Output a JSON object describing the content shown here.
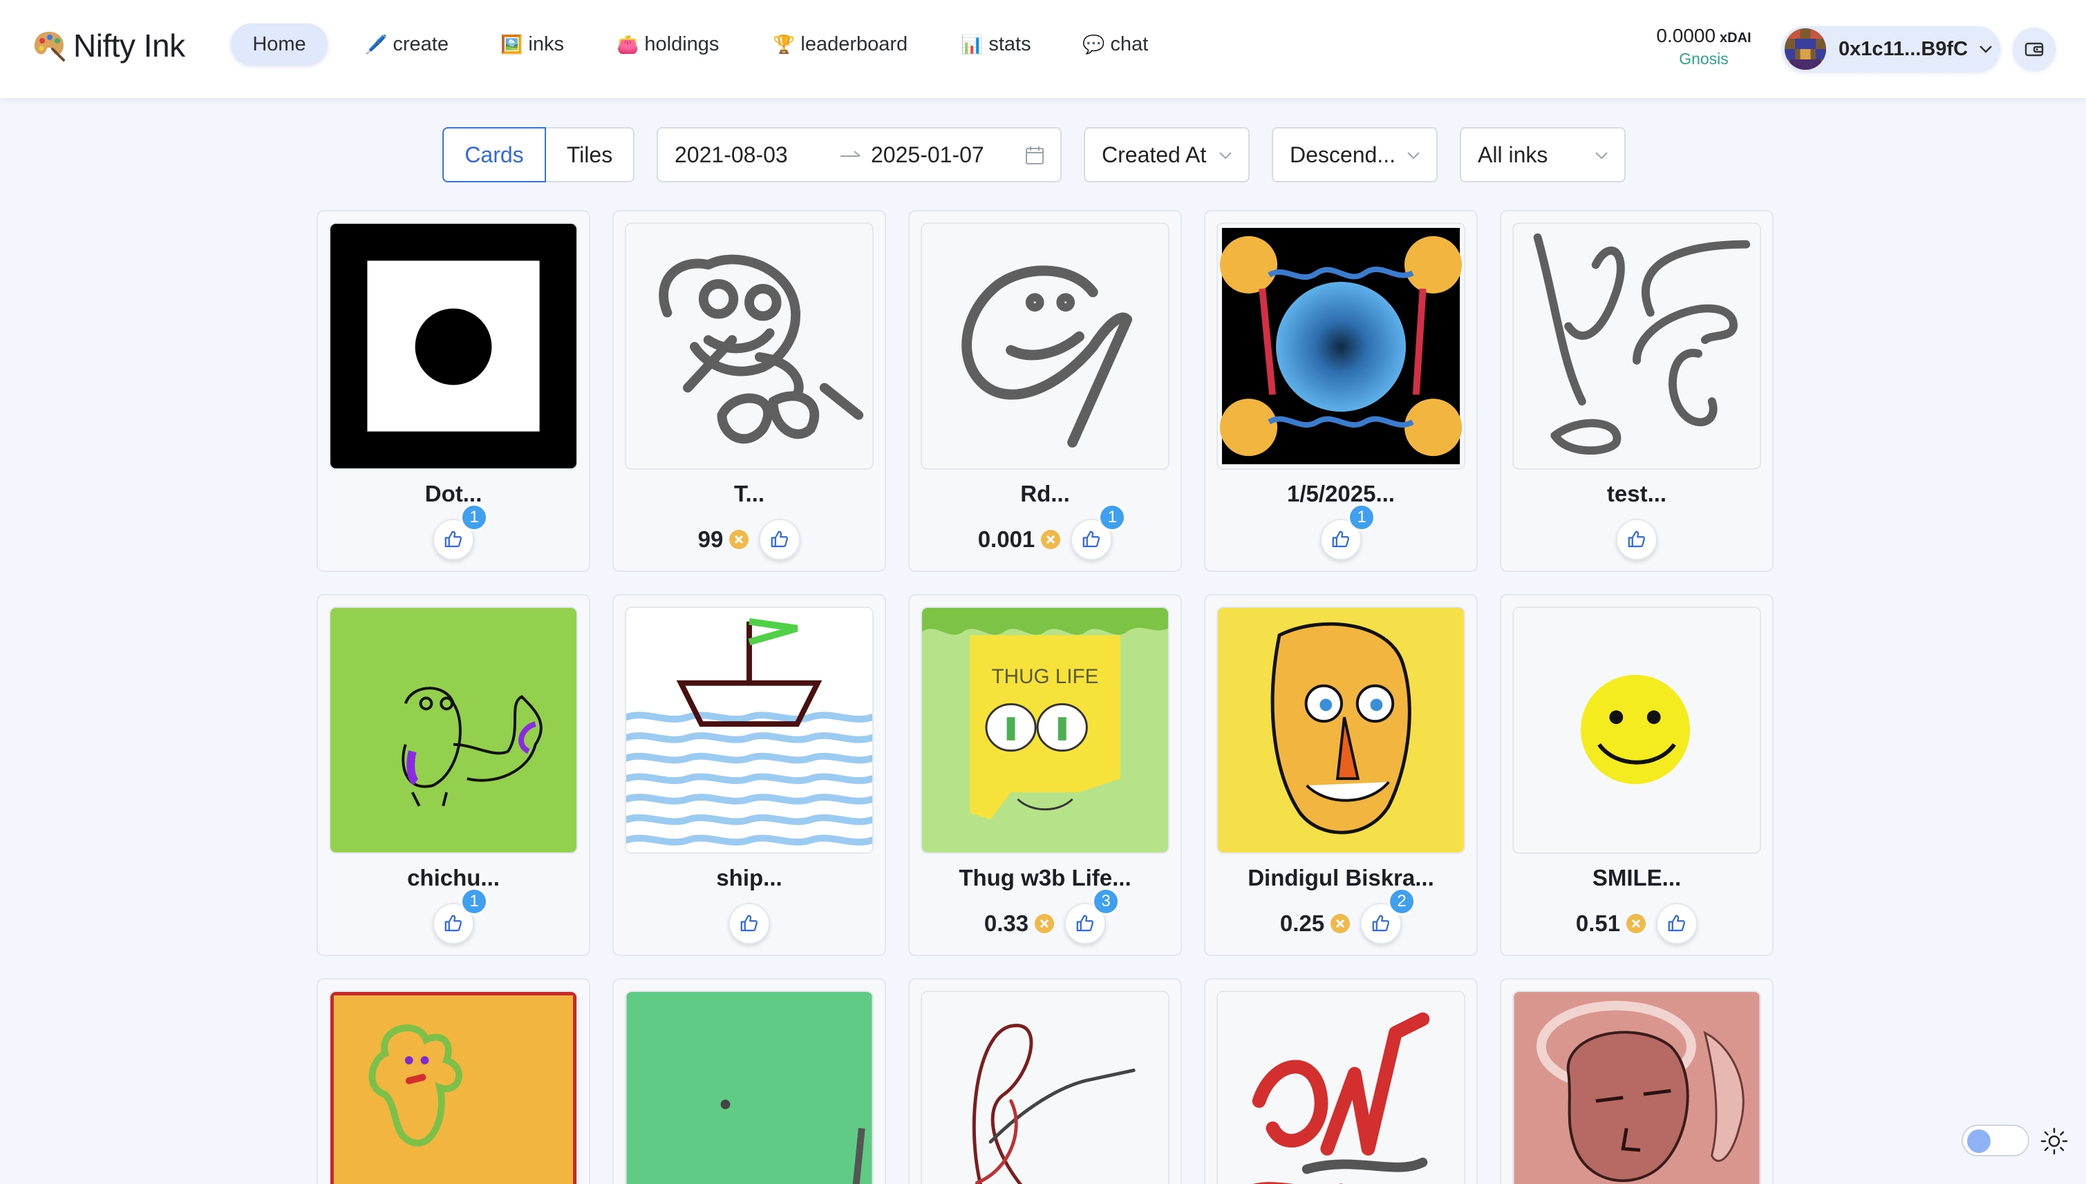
{
  "header": {
    "app_name": "Nifty Ink",
    "nav": [
      {
        "label": "Home",
        "emoji": ""
      },
      {
        "label": "create",
        "emoji": "🖊️"
      },
      {
        "label": "inks",
        "emoji": "🖼️"
      },
      {
        "label": "holdings",
        "emoji": "👛"
      },
      {
        "label": "leaderboard",
        "emoji": "🏆"
      },
      {
        "label": "stats",
        "emoji": "📊"
      },
      {
        "label": "chat",
        "emoji": "💬"
      }
    ],
    "balance": "0.0000",
    "currency": "xDAI",
    "network": "Gnosis",
    "address": "0x1c11...B9fC"
  },
  "toolbar": {
    "view_options": [
      "Cards",
      "Tiles"
    ],
    "selected_view": "Cards",
    "date_from": "2021-08-03",
    "date_to": "2025-01-07",
    "sort_by": "Created At",
    "order": "Descend...",
    "filter": "All inks"
  },
  "cards": [
    {
      "title": "Dot...",
      "price": "",
      "likes": "1"
    },
    {
      "title": "T...",
      "price": "99",
      "likes": ""
    },
    {
      "title": "Rd...",
      "price": "0.001",
      "likes": "1"
    },
    {
      "title": "1/5/2025...",
      "price": "",
      "likes": "1"
    },
    {
      "title": "test...",
      "price": "",
      "likes": ""
    },
    {
      "title": "chichu...",
      "price": "",
      "likes": "1"
    },
    {
      "title": "ship...",
      "price": "",
      "likes": ""
    },
    {
      "title": "Thug w3b Life...",
      "price": "0.33",
      "likes": "3"
    },
    {
      "title": "Dindigul Biskra...",
      "price": "0.25",
      "likes": "2"
    },
    {
      "title": "SMILE...",
      "price": "0.51",
      "likes": ""
    },
    {
      "title": "",
      "price": "",
      "likes": ""
    },
    {
      "title": "",
      "price": "",
      "likes": ""
    },
    {
      "title": "",
      "price": "",
      "likes": ""
    },
    {
      "title": "",
      "price": "",
      "likes": ""
    },
    {
      "title": "",
      "price": "",
      "likes": ""
    }
  ],
  "art_texts": {
    "thug_life": "THUG LIFE"
  },
  "icons": {
    "logo": "palette-icon",
    "dropdown": "chevron-down-icon",
    "calendar": "calendar-icon",
    "date_separator": "arrow-right-icon",
    "like": "thumbs-up-icon",
    "price_currency": "xdai-coin-icon",
    "wallet": "wallet-icon",
    "theme": "sun-icon"
  },
  "colors": {
    "accent": "#2f6ad8",
    "badge": "#3fa0ef",
    "network": "#2aa58a",
    "coin": "#f0b94b"
  }
}
